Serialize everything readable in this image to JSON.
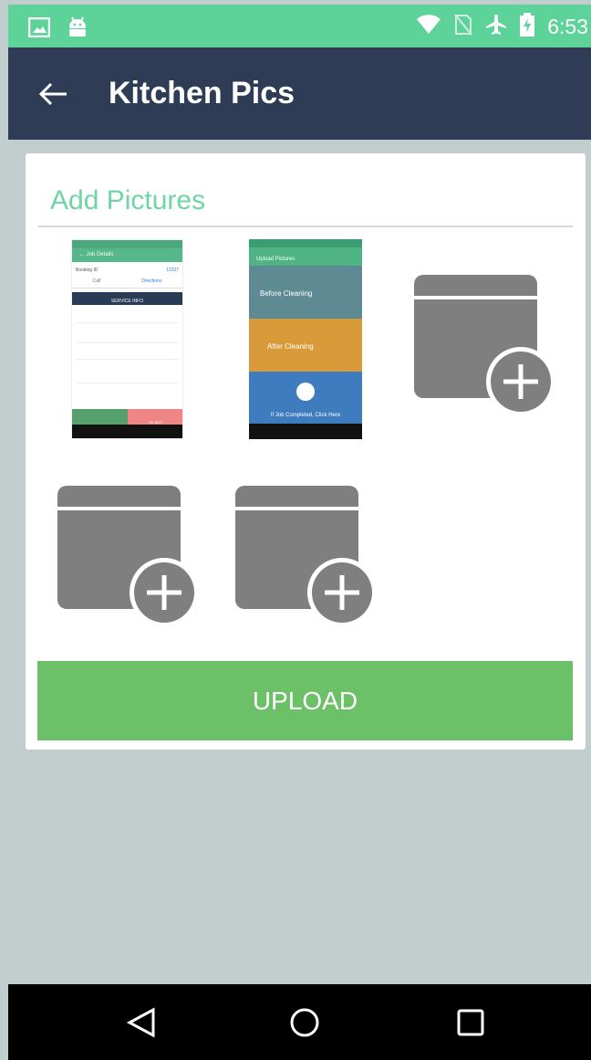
{
  "status_bar": {
    "time": "6:53",
    "icons": [
      "image-icon",
      "android-icon",
      "wifi-icon",
      "no-sim-icon",
      "airplane-icon",
      "battery-charging-icon"
    ]
  },
  "app_bar": {
    "back_icon": "arrow-left-icon",
    "title": "Kitchen Pics"
  },
  "card": {
    "title": "Add Pictures",
    "thumbnails": [
      {
        "name": "job-details-screenshot",
        "header": "Job Details",
        "booking_label": "Booking ID",
        "call_label": "Call",
        "directions_label": "Directions",
        "section": "SERVICE INFO",
        "reject_label": "REJECT"
      },
      {
        "name": "upload-pictures-screenshot",
        "header": "Upload Pictures",
        "before_label": "Before Cleaning",
        "after_label": "After Cleaning",
        "completed_label": "If Job Completed, Click Here"
      }
    ],
    "empty_slots": 3,
    "upload_label": "UPLOAD"
  },
  "nav_bar": {
    "icons": [
      "back-triangle-icon",
      "home-circle-icon",
      "recents-square-icon"
    ]
  },
  "colors": {
    "status_bar": "#5dd39a",
    "app_bar": "#2e3d55",
    "accent_green": "#6fd5a4",
    "upload_button": "#6cc068",
    "background": "#c2cdcd",
    "slot_gray": "#7f7f7f"
  }
}
